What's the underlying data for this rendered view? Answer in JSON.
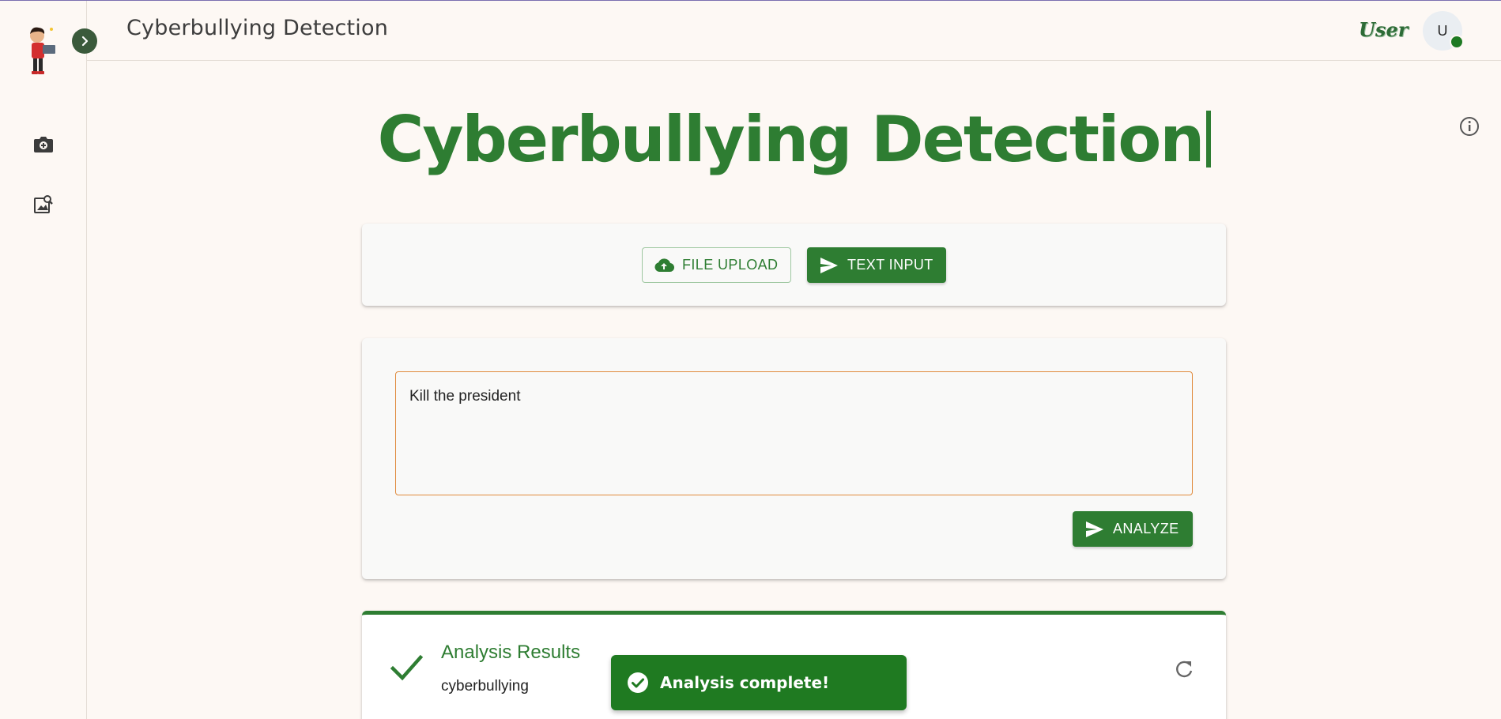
{
  "header": {
    "title": "Cyberbullying Detection",
    "user_label": "User",
    "avatar_initial": "U"
  },
  "main": {
    "hero_title": "Cyberbullying Detection"
  },
  "modes": {
    "file_upload_label": "FILE UPLOAD",
    "text_input_label": "TEXT INPUT"
  },
  "input": {
    "text_value": "Kill the president",
    "analyze_label": "ANALYZE"
  },
  "results": {
    "title": "Analysis Results",
    "label": "cyberbullying"
  },
  "toast": {
    "message": "Analysis complete!"
  },
  "colors": {
    "brand_green": "#2e7d32",
    "toast_green": "#1f7a21",
    "textarea_border": "#e08a3c",
    "background": "#fdf8f4"
  },
  "icons": {
    "sidebar": [
      "camera-plus-icon",
      "image-search-icon"
    ],
    "expand": "chevron-right-icon",
    "info": "info-icon",
    "upload": "cloud-upload-icon",
    "send": "send-icon",
    "success": "check-icon",
    "refresh": "refresh-icon",
    "toast": "check-circle-icon"
  }
}
